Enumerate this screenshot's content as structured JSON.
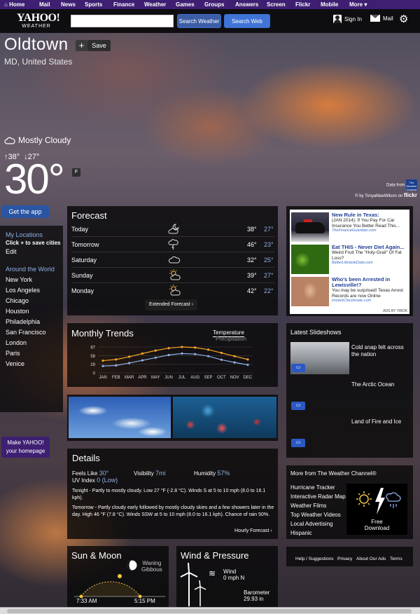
{
  "nav": {
    "items": [
      "Home",
      "Mail",
      "News",
      "Sports",
      "Finance",
      "Weather",
      "Games",
      "Groups",
      "Answers",
      "Screen",
      "Flickr",
      "Mobile",
      "More"
    ]
  },
  "header": {
    "logo_line1": "YAHOO!",
    "logo_line2": "WEATHER",
    "search_placeholder": "",
    "search_weather_label": "Search Weather",
    "search_web_label": "Search Web",
    "signin_label": "Sign In",
    "mail_label": "Mail",
    "gear_icon": "gear-icon"
  },
  "location": {
    "city": "Oldtown",
    "region": "MD, United States",
    "add_label": "+",
    "save_label": "Save"
  },
  "current": {
    "condition": "Mostly Cloudy",
    "high": "38°",
    "low": "27°",
    "temp": "30°",
    "unit": "F",
    "credit_line1": "Data from",
    "credit_line2": "© by TonyaMaeWilson on",
    "credit_brand": "flickr",
    "twc_badge": "The Weather Channel"
  },
  "side": {
    "get_app": "Get the app",
    "my_locations": "My Locations",
    "click_hint": "Click + to save cities",
    "edit": "Edit",
    "around": "Around the World",
    "cities": [
      "New York",
      "Los Angeles",
      "Chicago",
      "Houston",
      "Philadelphia",
      "San Francisco",
      "London",
      "Paris",
      "Venice"
    ],
    "make_line1": "Make YAHOO!",
    "make_line2": "your homepage"
  },
  "forecast": {
    "title": "Forecast",
    "rows": [
      {
        "day": "Today",
        "icon": "partly-cloudy-night-icon",
        "hi": "38°",
        "lo": "27°"
      },
      {
        "day": "Tomorrow",
        "icon": "thunderstorm-icon",
        "hi": "46°",
        "lo": "23°"
      },
      {
        "day": "Saturday",
        "icon": "cloudy-icon",
        "hi": "32°",
        "lo": "25°"
      },
      {
        "day": "Sunday",
        "icon": "partly-sunny-icon",
        "hi": "39°",
        "lo": "27°"
      },
      {
        "day": "Monday",
        "icon": "partly-sunny-icon",
        "hi": "42°",
        "lo": "22°"
      }
    ],
    "extended_label": "Extended Forecast ›"
  },
  "trends": {
    "title": "Monthly Trends",
    "tab_temperature": "Temperature",
    "tab_precipitation": "Precipitation",
    "y_ticks": [
      "87",
      "58",
      "29",
      "0"
    ]
  },
  "chart_data": {
    "type": "line",
    "categories": [
      "JAN",
      "FEB",
      "MAR",
      "APR",
      "MAY",
      "JUN",
      "JUL",
      "AUG",
      "SEP",
      "OCT",
      "NOV",
      "DEC"
    ],
    "series": [
      {
        "name": "",
        "color": "#f5a623",
        "values": [
          41,
          45,
          54,
          65,
          75,
          83,
          87,
          85,
          78,
          67,
          56,
          45
        ]
      },
      {
        "name": "",
        "color": "#8fb0e6",
        "values": [
          23,
          25,
          33,
          42,
          51,
          60,
          65,
          63,
          56,
          44,
          35,
          27
        ]
      }
    ],
    "ylim": [
      0,
      87
    ],
    "yticks": [
      0,
      29,
      58,
      87
    ]
  },
  "details": {
    "title": "Details",
    "feels_like_label": "Feels Like",
    "feels_like_value": "30°",
    "uv_label": "UV Index",
    "uv_value": "0 (Low)",
    "visibility_label": "Visibility",
    "visibility_value": "7mi",
    "humidity_label": "Humidity",
    "humidity_value": "57%",
    "tonight": "Tonight - Partly to mostly cloudy. Low 27 °F (-2.8 °C). Winds S at 5 to 10 mph (8.0 to 16.1 kph).",
    "tomorrow": "Tomorrow - Partly cloudy early followed by mostly cloudy skies and a few showers later in the day. High 46 °F (7.8 °C). Winds SSW at 5 to 10 mph (8.0 to 16.1 kph). Chance of rain 50%.",
    "hourly_label": "Hourly Forecast ›"
  },
  "sunmoon": {
    "title": "Sun & Moon",
    "moon_phase_line1": "Waning",
    "moon_phase_line2": "Gibbous",
    "sunrise": "7:33 AM",
    "sunset": "5:15 PM"
  },
  "wind": {
    "title": "Wind & Pressure",
    "wind_label": "Wind",
    "wind_value": "0 mph N",
    "barometer_label": "Barometer",
    "barometer_value": "29.93 in"
  },
  "ad": {
    "items": [
      {
        "headline": "New Rule in Texas:",
        "body": "(JAN 2014): If You Pay For Car Insurance You Better Read This...",
        "source": "TheFinanceGuardian.com"
      },
      {
        "headline": "Eat THIS - Never Diet Again...",
        "body": "Weird Fruit The \"Holy-Grail\" Of Fat Loss?",
        "source": "BetterLifestyleDaily.com"
      },
      {
        "headline": "Who's been Arrested in Lewisville!?",
        "body": "You may be surprised! Texas Arrest Records are now Online",
        "source": "InstantCheckmate.com"
      }
    ],
    "ads_by": "ADS BY YIBOK"
  },
  "slideshows": {
    "title": "Latest Slideshows",
    "items": [
      "Cold snap felt across the nation",
      "The Arctic Ocean",
      "Land of Fire and Ice"
    ]
  },
  "more": {
    "title": "More from The Weather Channel®",
    "links": [
      "Hurricane Tracker",
      "Interactive Radar Map",
      "Weather Films",
      "Top Weather Videos",
      "Local Advertising",
      "Hispanic"
    ],
    "free_line1": "Free",
    "free_line2": "Download"
  },
  "footer": {
    "links": [
      "Help / Suggestions",
      "Privacy",
      "About Our Ads",
      "Terms"
    ]
  }
}
